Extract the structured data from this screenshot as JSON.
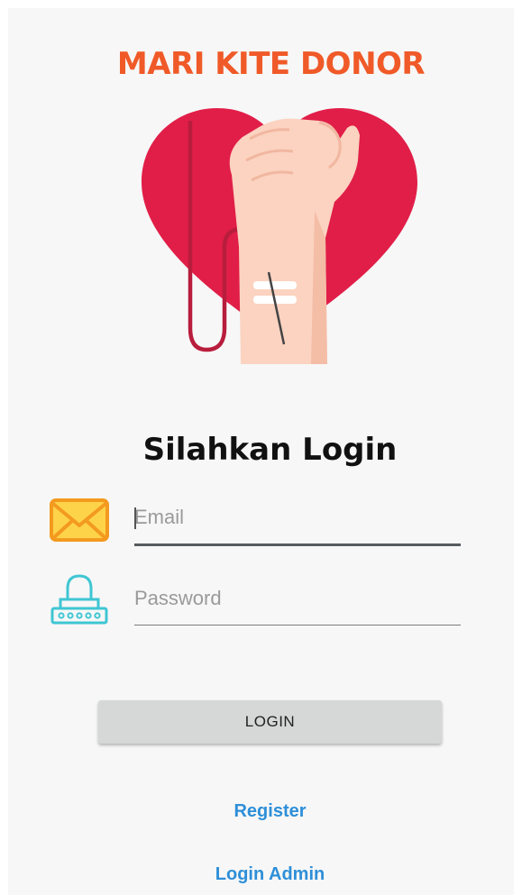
{
  "app": {
    "title": "MARI KITE DONOR"
  },
  "hero": {
    "icon": "heart-arm-blood-donation-illustration",
    "colors": {
      "heart": "#e11e48",
      "skin": "#fbd3c0",
      "tube": "#b81d3c"
    }
  },
  "login": {
    "heading": "Silahkan Login",
    "email": {
      "icon": "envelope-icon",
      "placeholder": "Email",
      "value": ""
    },
    "password": {
      "icon": "lock-icon",
      "placeholder": "Password",
      "value": ""
    },
    "button_label": "LOGIN"
  },
  "links": {
    "register": "Register",
    "login_admin": "Login Admin"
  },
  "colors": {
    "title": "#f05a28",
    "link": "#2e8fd8",
    "button": "#d6d7d7",
    "background": "#f7f7f7"
  }
}
